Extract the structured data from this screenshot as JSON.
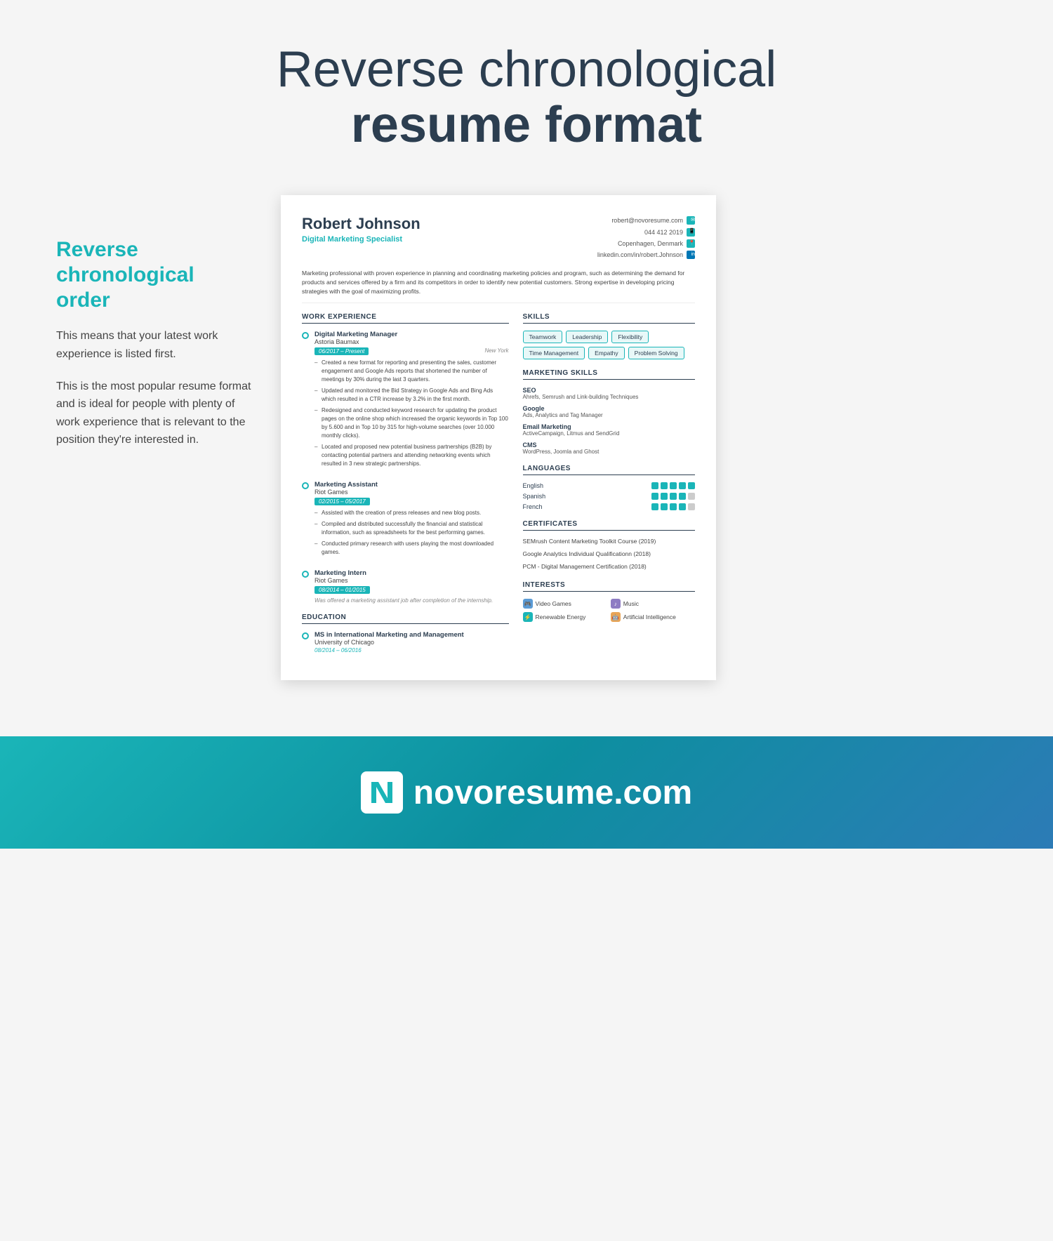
{
  "page": {
    "title_light": "Reverse chronological",
    "title_bold": "resume format"
  },
  "sidebar": {
    "heading": "Reverse chronological order",
    "paragraph1": "This means that your latest work experience is listed first.",
    "paragraph2": "This is the most popular resume format and is ideal for people with plenty of work experience that is relevant to the position they're interested in."
  },
  "resume": {
    "name": "Robert Johnson",
    "title": "Digital Marketing Specialist",
    "contact": {
      "email": "robert@novoresume.com",
      "phone": "044 412 2019",
      "location": "Copenhagen, Denmark",
      "linkedin": "linkedin.com/in/robert.Johnson"
    },
    "summary": "Marketing professional with proven experience in planning and coordinating marketing policies and program, such as determining the demand for products and services offered by a firm and its competitors in order to identify new potential customers. Strong expertise in developing pricing strategies with the goal of maximizing profits.",
    "work_experience_title": "WORK EXPERIENCE",
    "jobs": [
      {
        "title": "Digital Marketing Manager",
        "company": "Astoria Baumax",
        "date": "06/2017 – Present",
        "location": "New York",
        "bullets": [
          "Created a new format for reporting and presenting the sales, customer engagement and Google Ads reports that shortened the number of meetings by 30% during the last 3 quarters.",
          "Updated and monitored the Bid Strategy in Google Ads and Bing Ads which resulted in a CTR increase by 3.2% in the first month.",
          "Redesigned and conducted keyword research for updating the product pages on the online shop which increased the organic keywords in Top 100 by 5.600 and in Top 10 by 315 for high-volume searches (over 10.000 monthly clicks).",
          "Located and proposed new potential business partnerships (B2B) by contacting potential partners and attending networking events which resulted in 3 new strategic partnerships."
        ],
        "italic_note": null
      },
      {
        "title": "Marketing Assistant",
        "company": "Riot Games",
        "date": "02/2015 – 05/2017",
        "location": null,
        "bullets": [
          "Assisted with the creation of press releases and new blog posts.",
          "Compiled and distributed successfully the financial and statistical information, such as spreadsheets for the best performing games.",
          "Conducted primary research with users playing the most downloaded games."
        ],
        "italic_note": null
      },
      {
        "title": "Marketing Intern",
        "company": "Riot Games",
        "date": "08/2014 – 01/2015",
        "location": null,
        "bullets": [],
        "italic_note": "Was offered a marketing assistant job after completion of the internship."
      }
    ],
    "education_title": "EDUCATION",
    "education": [
      {
        "degree": "MS in International Marketing and Management",
        "school": "University of Chicago",
        "date": "08/2014 – 06/2016"
      }
    ],
    "skills_title": "SKILLS",
    "skills_tags": [
      "Teamwork",
      "Leadership",
      "Flexibility",
      "Time Management",
      "Empathy",
      "Problem Solving"
    ],
    "marketing_skills_title": "MARKETING SKILLS",
    "marketing_skills": [
      {
        "name": "SEO",
        "desc": "Ahrefs, Semrush and Link-building Techniques"
      },
      {
        "name": "Google",
        "desc": "Ads, Analytics and Tag Manager"
      },
      {
        "name": "Email Marketing",
        "desc": "ActiveCampaign, Litmus and SendGrid"
      },
      {
        "name": "CMS",
        "desc": "WordPress, Joomla and Ghost"
      }
    ],
    "languages_title": "LANGUAGES",
    "languages": [
      {
        "name": "English",
        "filled": 5,
        "total": 5
      },
      {
        "name": "Spanish",
        "filled": 4,
        "total": 5
      },
      {
        "name": "French",
        "filled": 4,
        "total": 5
      }
    ],
    "certificates_title": "CERTIFICATES",
    "certificates": [
      "SEMrush Content Marketing Toolkit Course (2019)",
      "Google Analytics Individual Qualificationn (2018)",
      "PCM - Digital Management Certification (2018)"
    ],
    "interests_title": "INTERESTS",
    "interests": [
      {
        "label": "Video Games",
        "icon": "🎮",
        "color": "blue"
      },
      {
        "label": "Music",
        "icon": "♪",
        "color": "purple"
      },
      {
        "label": "Renewable Energy",
        "icon": "⚡",
        "color": "teal"
      },
      {
        "label": "Artificial Intelligence",
        "icon": "🤖",
        "color": "orange"
      }
    ]
  },
  "footer": {
    "brand": "novoresume.com"
  }
}
